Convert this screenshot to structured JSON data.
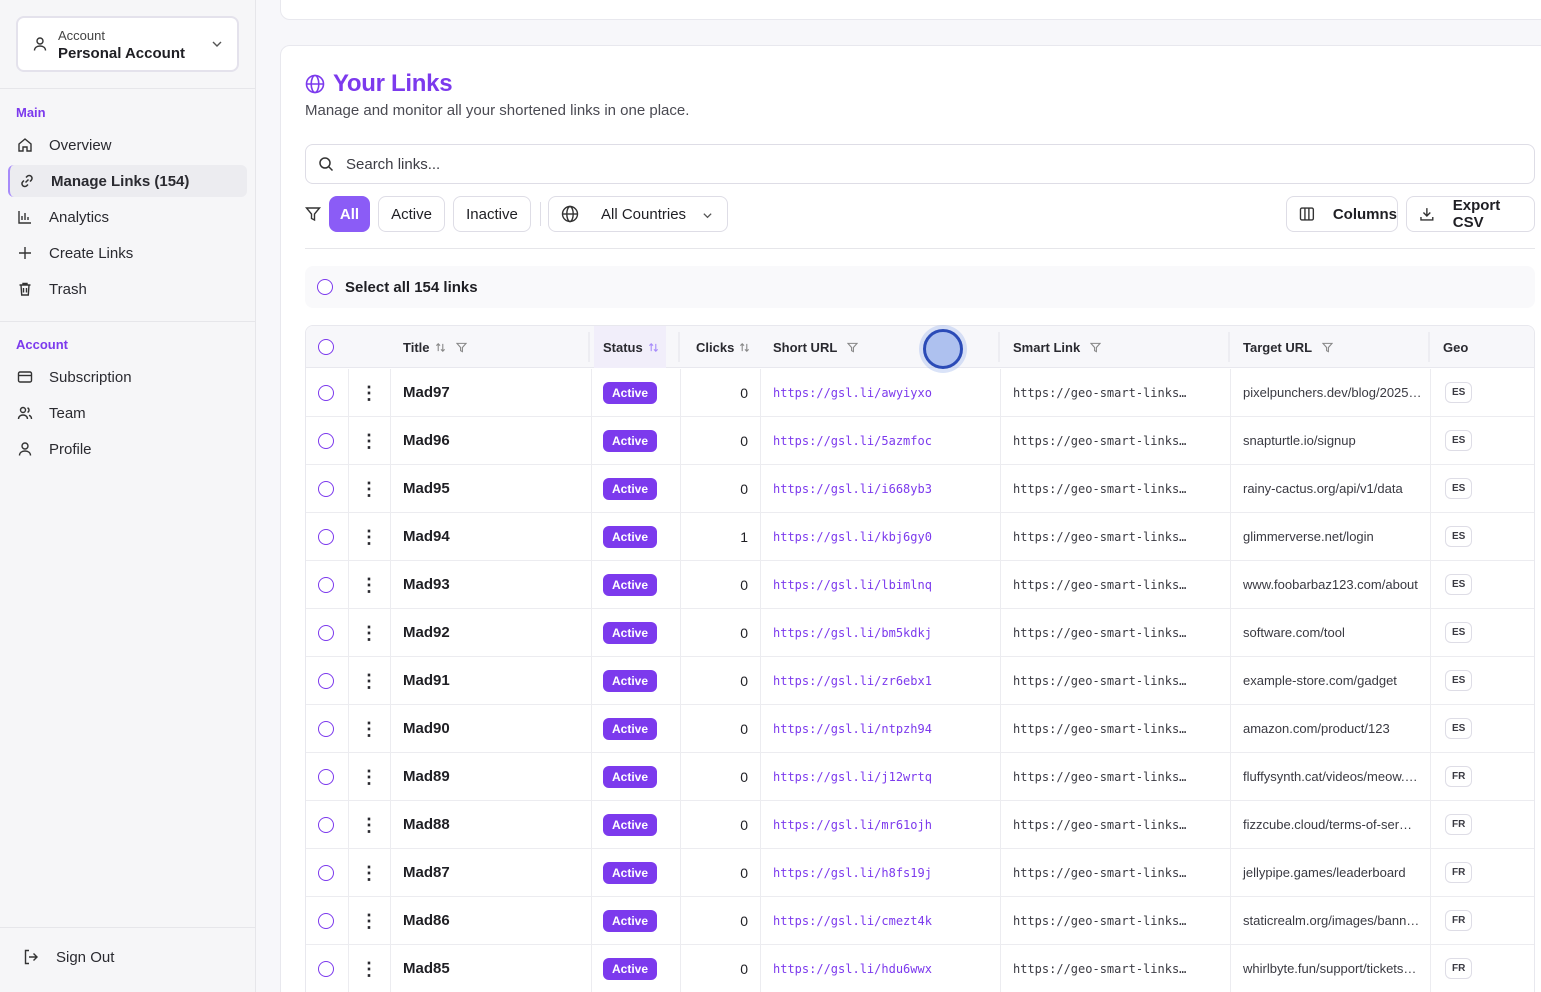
{
  "sidebar": {
    "account": {
      "label": "Account",
      "value": "Personal Account"
    },
    "main_section": "Main",
    "main_items": [
      {
        "label": "Overview",
        "icon": "home-icon"
      },
      {
        "label": "Manage Links (154)",
        "icon": "link-icon",
        "active": true
      },
      {
        "label": "Analytics",
        "icon": "bar-chart-icon"
      },
      {
        "label": "Create Links",
        "icon": "plus-icon"
      },
      {
        "label": "Trash",
        "icon": "trash-icon"
      }
    ],
    "account_section": "Account",
    "account_items": [
      {
        "label": "Subscription",
        "icon": "credit-card-icon"
      },
      {
        "label": "Team",
        "icon": "users-icon"
      },
      {
        "label": "Profile",
        "icon": "user-icon"
      }
    ],
    "sign_out": "Sign Out"
  },
  "page": {
    "title": "Your Links",
    "subtitle": "Manage and monitor all your shortened links in one place."
  },
  "search": {
    "placeholder": "Search links..."
  },
  "filters": {
    "all": "All",
    "active": "Active",
    "inactive": "Inactive",
    "country": "All Countries",
    "columns": "Columns",
    "export": "Export CSV"
  },
  "select_all": "Select all 154 links",
  "table": {
    "headers": {
      "title": "Title",
      "status": "Status",
      "clicks": "Clicks",
      "short_url": "Short URL",
      "smart_link": "Smart Link",
      "target_url": "Target URL",
      "geo": "Geo"
    },
    "rows": [
      {
        "title": "Mad97",
        "status": "Active",
        "clicks": "0",
        "short": "https://gsl.li/awyiyxo",
        "smart": "https://geo-smart-links…",
        "target": "pixelpunchers.dev/blog/2025…",
        "geo": "ES"
      },
      {
        "title": "Mad96",
        "status": "Active",
        "clicks": "0",
        "short": "https://gsl.li/5azmfoc",
        "smart": "https://geo-smart-links…",
        "target": "snapturtle.io/signup",
        "geo": "ES"
      },
      {
        "title": "Mad95",
        "status": "Active",
        "clicks": "0",
        "short": "https://gsl.li/i668yb3",
        "smart": "https://geo-smart-links…",
        "target": "rainy-cactus.org/api/v1/data",
        "geo": "ES"
      },
      {
        "title": "Mad94",
        "status": "Active",
        "clicks": "1",
        "short": "https://gsl.li/kbj6gy0",
        "smart": "https://geo-smart-links…",
        "target": "glimmerverse.net/login",
        "geo": "ES"
      },
      {
        "title": "Mad93",
        "status": "Active",
        "clicks": "0",
        "short": "https://gsl.li/lbimlnq",
        "smart": "https://geo-smart-links…",
        "target": "www.foobarbaz123.com/about",
        "geo": "ES"
      },
      {
        "title": "Mad92",
        "status": "Active",
        "clicks": "0",
        "short": "https://gsl.li/bm5kdkj",
        "smart": "https://geo-smart-links…",
        "target": "software.com/tool",
        "geo": "ES"
      },
      {
        "title": "Mad91",
        "status": "Active",
        "clicks": "0",
        "short": "https://gsl.li/zr6ebx1",
        "smart": "https://geo-smart-links…",
        "target": "example-store.com/gadget",
        "geo": "ES"
      },
      {
        "title": "Mad90",
        "status": "Active",
        "clicks": "0",
        "short": "https://gsl.li/ntpzh94",
        "smart": "https://geo-smart-links…",
        "target": "amazon.com/product/123",
        "geo": "ES"
      },
      {
        "title": "Mad89",
        "status": "Active",
        "clicks": "0",
        "short": "https://gsl.li/j12wrtq",
        "smart": "https://geo-smart-links…",
        "target": "fluffysynth.cat/videos/meow.…",
        "geo": "FR"
      },
      {
        "title": "Mad88",
        "status": "Active",
        "clicks": "0",
        "short": "https://gsl.li/mr61ojh",
        "smart": "https://geo-smart-links…",
        "target": "fizzcube.cloud/terms-of-ser…",
        "geo": "FR"
      },
      {
        "title": "Mad87",
        "status": "Active",
        "clicks": "0",
        "short": "https://gsl.li/h8fs19j",
        "smart": "https://geo-smart-links…",
        "target": "jellypipe.games/leaderboard",
        "geo": "FR"
      },
      {
        "title": "Mad86",
        "status": "Active",
        "clicks": "0",
        "short": "https://gsl.li/cmezt4k",
        "smart": "https://geo-smart-links…",
        "target": "staticrealm.org/images/bann…",
        "geo": "FR"
      },
      {
        "title": "Mad85",
        "status": "Active",
        "clicks": "0",
        "short": "https://gsl.li/hdu6wwx",
        "smart": "https://geo-smart-links…",
        "target": "whirlbyte.fun/support/tickets…",
        "geo": "FR"
      }
    ]
  },
  "colors": {
    "accent": "#7c3aed",
    "accent_light": "#8b5cf6"
  }
}
